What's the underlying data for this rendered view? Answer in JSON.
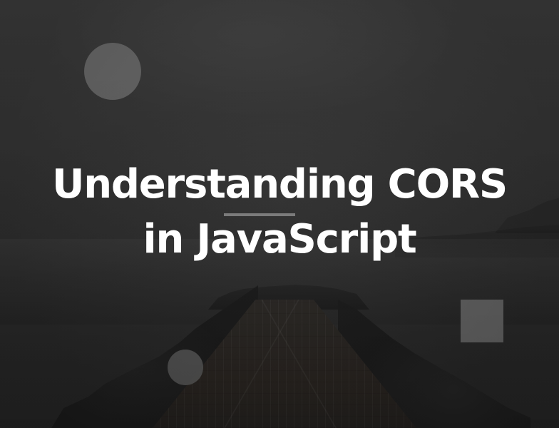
{
  "hero": {
    "title_line_1": "Understanding CORS",
    "title_line_2": "in JavaScript"
  },
  "decorations": {
    "large_circle_color": "#6a6a6a",
    "small_circle_color": "#5a5a5a",
    "square_color": "#6a6a6a",
    "divider_color": "#7b7b7b"
  }
}
